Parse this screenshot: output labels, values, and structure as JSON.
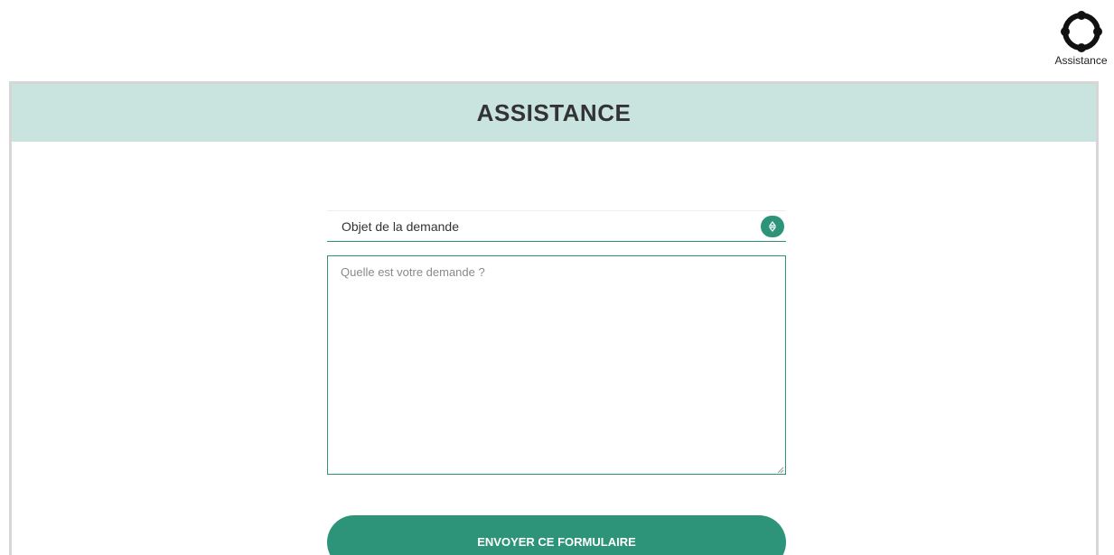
{
  "help_link": {
    "label": "Assistance",
    "icon": "lifebuoy-icon"
  },
  "panel": {
    "title": "ASSISTANCE"
  },
  "form": {
    "subject_select": {
      "selected_value": "Objet de la demande",
      "icon": "select-arrows-icon"
    },
    "request_textarea": {
      "placeholder": "Quelle est votre demande ?",
      "value": ""
    },
    "submit_label": "ENVOYER CE FORMULAIRE"
  },
  "colors": {
    "accent": "#2e9479",
    "header_background": "#c9e4df",
    "panel_border": "#d6d6d6",
    "title_text": "#333333"
  }
}
